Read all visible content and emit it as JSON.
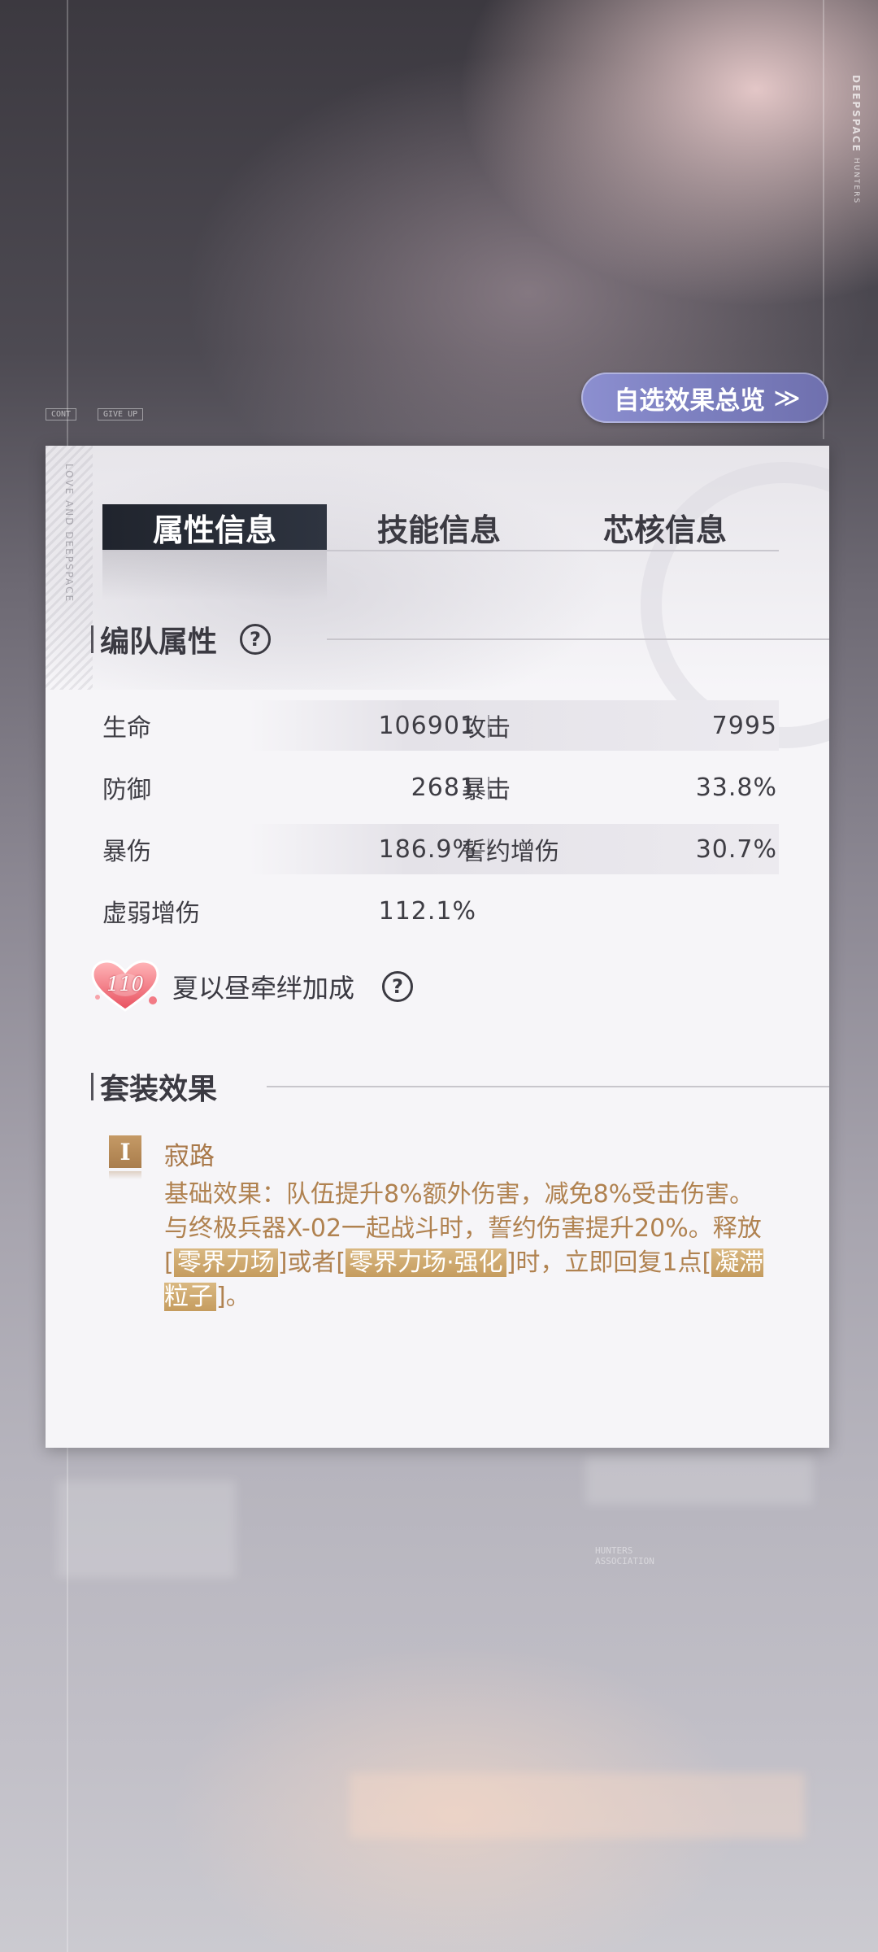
{
  "brand_vertical": {
    "main": "DEEPSPACE",
    "sub": "HUNTERS"
  },
  "deco": {
    "chips": [
      "CONT",
      "GIVE UP"
    ],
    "panel_side_text": "LOVE AND DEEPSPACE",
    "bg_association": "HUNTERS ASSOCIATION"
  },
  "overview_button": {
    "label": "自选效果总览",
    "chevron": "≫"
  },
  "tabs": [
    {
      "label": "属性信息",
      "active": true
    },
    {
      "label": "技能信息",
      "active": false
    },
    {
      "label": "芯核信息",
      "active": false
    }
  ],
  "team_attributes": {
    "title": "编队属性",
    "help_icon": "?",
    "rows": [
      {
        "left_label": "生命",
        "left_value": "106901",
        "right_label": "攻击",
        "right_value": "7995"
      },
      {
        "left_label": "防御",
        "left_value": "2681",
        "right_label": "暴击",
        "right_value": "33.8%"
      },
      {
        "left_label": "暴伤",
        "left_value": "186.9%",
        "right_label": "誓约增伤",
        "right_value": "30.7%"
      },
      {
        "left_label": "虚弱增伤",
        "left_value": "112.1%",
        "right_label": "",
        "right_value": ""
      }
    ]
  },
  "bond": {
    "level": "110",
    "label": "夏以昼牵绊加成",
    "help_icon": "?"
  },
  "set_effect": {
    "title": "套装效果",
    "icon_text": "I",
    "name": "寂路",
    "desc_parts": [
      "基础效果：队伍提升8%额外伤害，减免8%受击伤害。与终极兵器X-02一起战斗时，誓约伤害提升20%。释放[",
      "零界力场",
      "]或者[",
      "零界力场·强化",
      "]时，立即回复1点[",
      "凝滞粒子",
      "]。"
    ]
  },
  "colors": {
    "accent_button": "#7a7dbd",
    "active_tab": "#2a2f3a",
    "gold_text": "#b08250",
    "highlight": "#c9a066"
  }
}
